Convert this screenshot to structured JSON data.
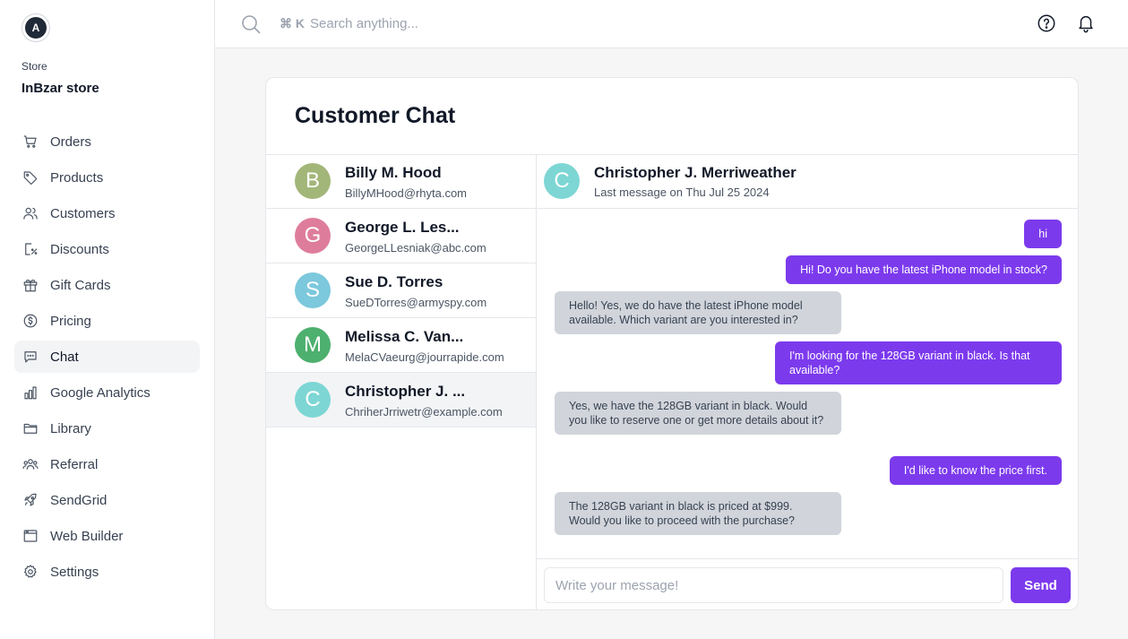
{
  "sidebar": {
    "logo_letter": "A",
    "store_caption": "Store",
    "store_name": "InBzar store",
    "items": [
      {
        "label": "Orders",
        "icon": "cart-icon"
      },
      {
        "label": "Products",
        "icon": "tag-icon"
      },
      {
        "label": "Customers",
        "icon": "users-icon"
      },
      {
        "label": "Discounts",
        "icon": "receipt-percent-icon"
      },
      {
        "label": "Gift Cards",
        "icon": "gift-icon"
      },
      {
        "label": "Pricing",
        "icon": "currency-dollar-icon"
      },
      {
        "label": "Chat",
        "icon": "chat-bubble-icon",
        "active": true
      },
      {
        "label": "Google Analytics",
        "icon": "bar-chart-icon"
      },
      {
        "label": "Library",
        "icon": "folder-icon"
      },
      {
        "label": "Referral",
        "icon": "user-group-icon"
      },
      {
        "label": "SendGrid",
        "icon": "rocket-icon"
      },
      {
        "label": "Web Builder",
        "icon": "browser-window-icon"
      },
      {
        "label": "Settings",
        "icon": "gear-icon"
      }
    ]
  },
  "topbar": {
    "shortcut": "⌘ K",
    "search_placeholder": "Search anything...",
    "help_icon": "question-circle-icon",
    "notification_icon": "bell-icon"
  },
  "chat": {
    "title": "Customer Chat",
    "contacts": [
      {
        "initial": "B",
        "name": "Billy M. Hood",
        "email": "BillyMHood@rhyta.com",
        "color": "#a3b679"
      },
      {
        "initial": "G",
        "name": "George L. Les...",
        "email": "GeorgeLLesniak@abc.com",
        "color": "#de7d9b"
      },
      {
        "initial": "S",
        "name": "Sue D. Torres",
        "email": "SueDTorres@armyspy.com",
        "color": "#7cc8dc"
      },
      {
        "initial": "M",
        "name": "Melissa C. Van...",
        "email": "MelaCVaeurg@jourrapide.com",
        "color": "#4db06e"
      },
      {
        "initial": "C",
        "name": "Christopher J. ...",
        "email": "ChriherJrriwetr@example.com",
        "color": "#7dd6d4",
        "active": true
      }
    ],
    "active_contact": {
      "initial": "C",
      "name": "Christopher J. Merriweather",
      "last_message": "Last message on Thu Jul 25 2024",
      "color": "#7dd6d4"
    },
    "messages": [
      {
        "direction": "out",
        "text": "hi"
      },
      {
        "direction": "out",
        "text": "Hi! Do you have the latest iPhone model in stock?"
      },
      {
        "direction": "in",
        "text": "Hello! Yes, we do have the latest iPhone model available. Which variant are you interested in?"
      },
      {
        "direction": "out",
        "text": "I'm looking for the 128GB variant in black. Is that available?"
      },
      {
        "direction": "in",
        "text": "Yes, we have the 128GB variant in black. Would you like to reserve one or get more details about it?"
      },
      {
        "direction": "out",
        "text": "I'd like to know the price first."
      },
      {
        "direction": "in",
        "text": "The 128GB variant in black is priced at $999. Would you like to proceed with the purchase?"
      }
    ],
    "composer_placeholder": "Write your message!",
    "send_label": "Send"
  },
  "colors": {
    "accent": "#7c3aed",
    "incoming_bubble": "#d1d5db"
  }
}
